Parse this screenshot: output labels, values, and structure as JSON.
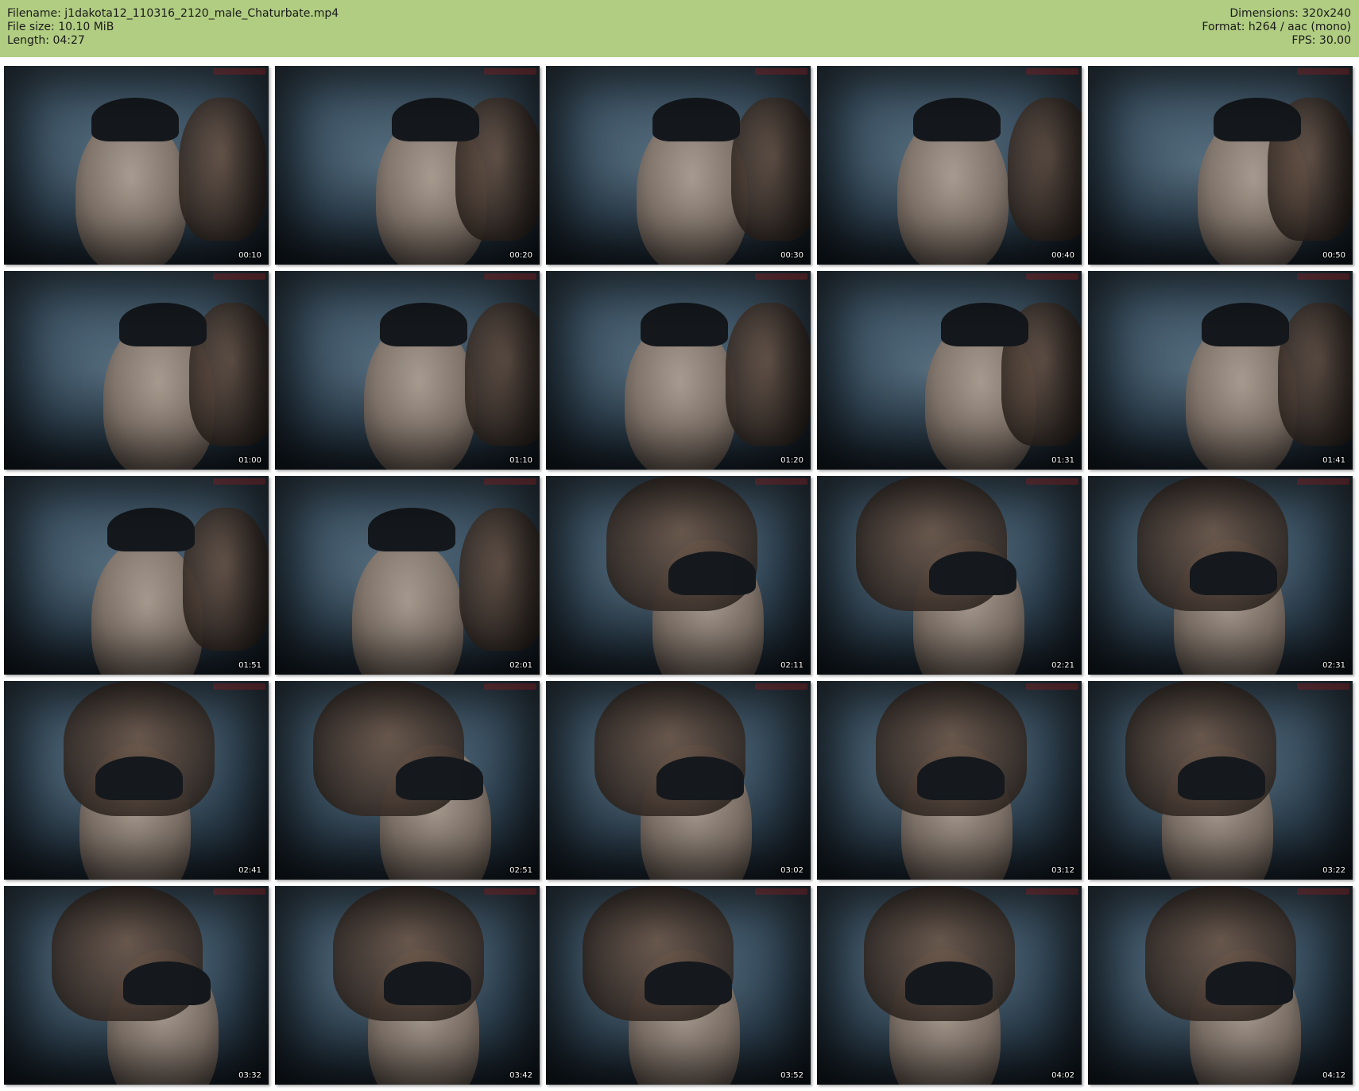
{
  "header": {
    "filename": "Filename: j1dakota12_110316_2120_male_Chaturbate.mp4",
    "filesize": "File size: 10.10 MiB",
    "length": "Length: 04:27",
    "dimensions": "Dimensions: 320x240",
    "format": "Format: h264 / aac (mono)",
    "fps": "FPS: 30.00"
  },
  "colors": {
    "header_bg": "#b1cd82",
    "page_bg": "#ffffff"
  },
  "thumbnails": [
    "00:10",
    "00:20",
    "00:30",
    "00:40",
    "00:50",
    "01:00",
    "01:10",
    "01:20",
    "01:31",
    "01:41",
    "01:51",
    "02:01",
    "02:11",
    "02:21",
    "02:31",
    "02:41",
    "02:51",
    "03:02",
    "03:12",
    "03:22",
    "03:32",
    "03:42",
    "03:52",
    "04:02",
    "04:12"
  ]
}
